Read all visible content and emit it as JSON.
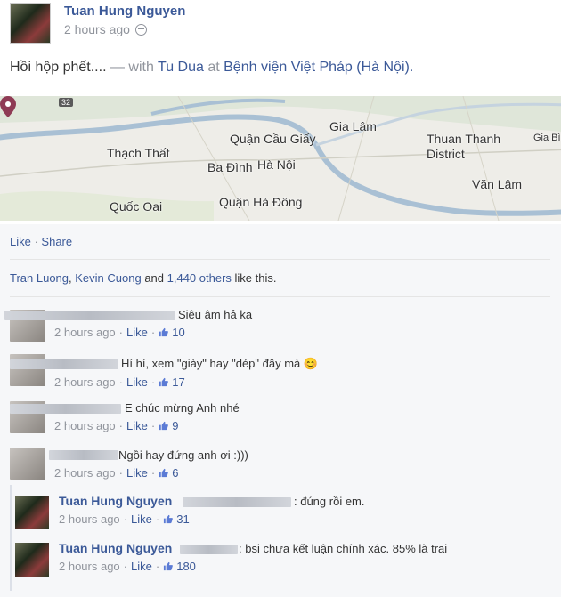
{
  "post": {
    "author": "Tuan Hung Nguyen",
    "time": "2 hours ago",
    "status_text": "Hồi hộp phết....",
    "with_prefix": " — with ",
    "with_person": "Tu Dua",
    "at_word": " at ",
    "place": "Bệnh viện Việt Pháp (Hà Nội).",
    "map": {
      "route_shield": "32",
      "labels": [
        "Quận Cầu Giấy",
        "Gia Lâm",
        "Thuan Thanh",
        "District",
        "Gia Bì",
        "Thạch Thất",
        "Ba Đình",
        "Hà Nội",
        "Văn Lâm",
        "Quốc Oai",
        "Quận Hà Đông"
      ],
      "pin_color": "#8f3b55"
    }
  },
  "actions": {
    "like": "Like",
    "sep": " · ",
    "share": "Share"
  },
  "likes": {
    "person1": "Tran Luong",
    "comma": ", ",
    "person2": "Kevin Cuong",
    "and": " and ",
    "others": "1,440 others",
    "suffix": " like this."
  },
  "comments": [
    {
      "text": "Siêu âm hả ka",
      "time": "2 hours ago",
      "like": "Like",
      "count": "10"
    },
    {
      "text": "Hí hí, xem \"giày\" hay \"dép\" đây mà 😊",
      "time": "2 hours ago",
      "like": "Like",
      "count": "17"
    },
    {
      "text": "E chúc mừng Anh nhé",
      "time": "2 hours ago",
      "like": "Like",
      "count": "9"
    },
    {
      "text": "Ngồi hay đứng anh ơi :)))",
      "time": "2 hours ago",
      "like": "Like",
      "count": "6"
    }
  ],
  "replies": [
    {
      "name": "Tuan Hung Nguyen",
      "text": ": đúng rồi em.",
      "time": "2 hours ago",
      "like": "Like",
      "count": "31"
    },
    {
      "name": "Tuan Hung Nguyen",
      "text": ": bsi chưa kết luận chính xác. 85% là trai",
      "time": "2 hours ago",
      "like": "Like",
      "count": "180"
    }
  ],
  "colors": {
    "link": "#3b5998",
    "muted": "#90949c",
    "feedback_bg": "#f6f7f9",
    "map_bg": "#eeede8"
  }
}
